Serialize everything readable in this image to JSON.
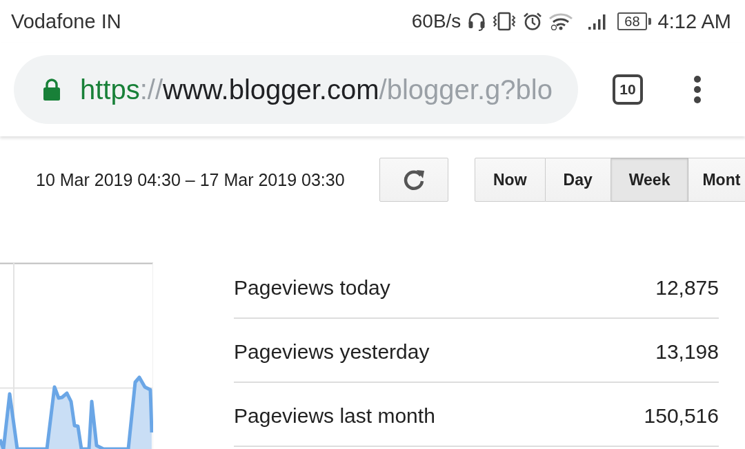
{
  "status_bar": {
    "carrier": "Vodafone IN",
    "net_speed": "60B/s",
    "battery": "68",
    "time": "4:12 AM"
  },
  "browser": {
    "secure": true,
    "url_parts": [
      {
        "kind": "scheme",
        "text": "https"
      },
      {
        "kind": "punct",
        "text": "://"
      },
      {
        "kind": "host",
        "text": "www.blogger.com"
      },
      {
        "kind": "path",
        "text": "/blogger.g?blo"
      }
    ],
    "tab_count": "10"
  },
  "range": {
    "label": "10 Mar 2019 04:30 – 17 Mar 2019 03:30",
    "periods": [
      {
        "label": "Now",
        "selected": false
      },
      {
        "label": "Day",
        "selected": false
      },
      {
        "label": "Week",
        "selected": true
      },
      {
        "label": "Mont",
        "selected": false
      }
    ]
  },
  "stats": [
    {
      "label": "Pageviews today",
      "value": "12,875"
    },
    {
      "label": "Pageviews yesterday",
      "value": "13,198"
    },
    {
      "label": "Pageviews last month",
      "value": "150,516"
    }
  ]
}
